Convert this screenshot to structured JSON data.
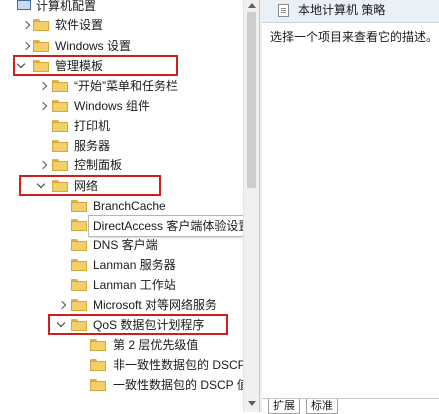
{
  "tree": {
    "items": [
      {
        "label": "计算机配置",
        "expander": "none",
        "icon": "computer-icon"
      },
      {
        "label": "软件设置",
        "expander": "right",
        "icon": "folder-icon"
      },
      {
        "label": "Windows 设置",
        "expander": "right",
        "icon": "folder-icon"
      },
      {
        "label": "管理模板",
        "expander": "down",
        "icon": "folder-icon"
      },
      {
        "label": "“开始”菜单和任务栏",
        "expander": "right",
        "icon": "folder-icon"
      },
      {
        "label": "Windows 组件",
        "expander": "right",
        "icon": "folder-icon"
      },
      {
        "label": "打印机",
        "expander": "none",
        "icon": "folder-icon"
      },
      {
        "label": "服务器",
        "expander": "none",
        "icon": "folder-icon"
      },
      {
        "label": "控制面板",
        "expander": "right",
        "icon": "folder-icon"
      },
      {
        "label": "网络",
        "expander": "down",
        "icon": "folder-icon"
      },
      {
        "label": "BranchCache",
        "expander": "none",
        "icon": "folder-icon"
      },
      {
        "label": "DirectAccess 客户端体验设置",
        "expander": "none",
        "icon": "folder-icon"
      },
      {
        "label": "DNS 客户端",
        "expander": "none",
        "icon": "folder-icon"
      },
      {
        "label": "Lanman 服务器",
        "expander": "none",
        "icon": "folder-icon"
      },
      {
        "label": "Lanman 工作站",
        "expander": "none",
        "icon": "folder-icon"
      },
      {
        "label": "Microsoft 对等网络服务",
        "expander": "right",
        "icon": "folder-icon"
      },
      {
        "label": "QoS 数据包计划程序",
        "expander": "down",
        "icon": "folder-icon"
      },
      {
        "label": "第 2 层优先级值",
        "expander": "none",
        "icon": "folder-icon"
      },
      {
        "label": "非一致性数据包的 DSCP",
        "expander": "none",
        "icon": "folder-icon"
      },
      {
        "label": "一致性数据包的 DSCP 值",
        "expander": "none",
        "icon": "folder-icon"
      }
    ],
    "tooltip": "DirectAccess 客户端体验设置"
  },
  "panel": {
    "title": "本地计算机 策略",
    "description": "选择一个项目来查看它的描述。"
  },
  "tabs": [
    "扩展",
    "标准"
  ],
  "colors": {
    "highlight": "#d21d1d",
    "folder": "#f3cf6a"
  }
}
